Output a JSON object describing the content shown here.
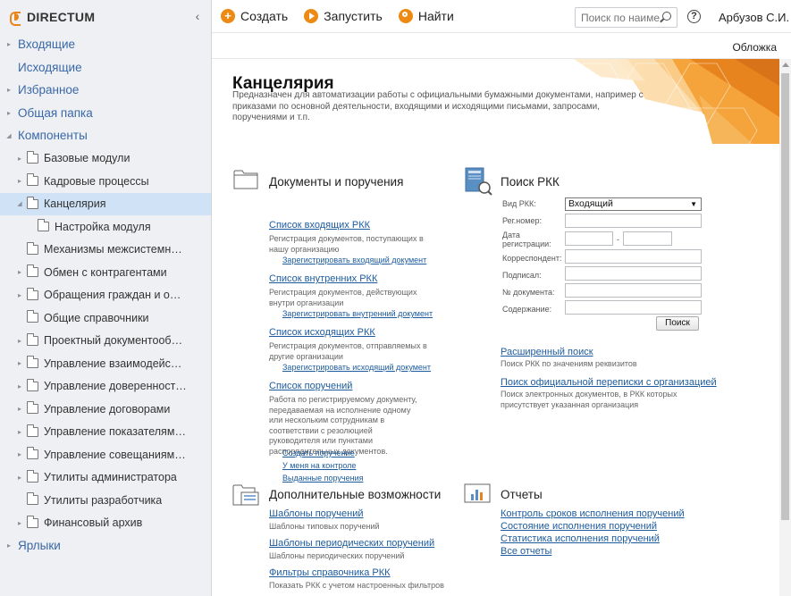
{
  "app": {
    "logo_text": "DIRECTUM",
    "collapse_icon": "chevron-left-icon"
  },
  "toolbar": {
    "create_label": "Создать",
    "run_label": "Запустить",
    "find_label": "Найти",
    "search_placeholder": "Поиск по наиме...",
    "user_name": "Арбузов С.И.",
    "accent_color": "#ec8a14"
  },
  "sidebar": {
    "items": [
      {
        "label": "Входящие",
        "level": 0,
        "expanded": false,
        "has_toggle": true
      },
      {
        "label": "Исходящие",
        "level": 0,
        "has_toggle": false
      },
      {
        "label": "Избранное",
        "level": 0,
        "expanded": false,
        "has_toggle": true
      },
      {
        "label": "Общая папка",
        "level": 0,
        "expanded": false,
        "has_toggle": true
      },
      {
        "label": "Компоненты",
        "level": 0,
        "expanded": true,
        "has_toggle": true
      },
      {
        "label": "Базовые модули",
        "level": 1,
        "has_toggle": true
      },
      {
        "label": "Кадровые процессы",
        "level": 1,
        "has_toggle": true
      },
      {
        "label": "Канцелярия",
        "level": 1,
        "has_toggle": true,
        "expanded": true,
        "selected": true
      },
      {
        "label": "Настройка модуля",
        "level": 2,
        "has_toggle": false
      },
      {
        "label": "Механизмы межсистемного обмена",
        "level": 1,
        "has_toggle": false
      },
      {
        "label": "Обмен с контрагентами",
        "level": 1,
        "has_toggle": true
      },
      {
        "label": "Обращения граждан и организаций",
        "level": 1,
        "has_toggle": true
      },
      {
        "label": "Общие справочники",
        "level": 1,
        "has_toggle": false
      },
      {
        "label": "Проектный документооборот",
        "level": 1,
        "has_toggle": true
      },
      {
        "label": "Управление взаимодействием",
        "level": 1,
        "has_toggle": true
      },
      {
        "label": "Управление доверенностями",
        "level": 1,
        "has_toggle": true
      },
      {
        "label": "Управление договорами",
        "level": 1,
        "has_toggle": true
      },
      {
        "label": "Управление показателями эффективности",
        "level": 1,
        "has_toggle": true
      },
      {
        "label": "Управление совещаниями и ВКС",
        "level": 1,
        "has_toggle": true
      },
      {
        "label": "Утилиты администратора",
        "level": 1,
        "has_toggle": true
      },
      {
        "label": "Утилиты разработчика",
        "level": 1,
        "has_toggle": false
      },
      {
        "label": "Финансовый архив",
        "level": 1,
        "has_toggle": true
      },
      {
        "label": "Ярлыки",
        "level": 0,
        "expanded": false,
        "has_toggle": true
      }
    ]
  },
  "content": {
    "cover_link": "Обложка",
    "title": "Канцелярия",
    "description": "Предназначен для автоматизации работы с официальными бумажными документами, например с приказами по основной деятельности, входящими и исходящими письмами, запросами, поручениями и т.п.",
    "documents": {
      "title": "Документы и поручения",
      "items": [
        {
          "link": "Список входящих РКК",
          "desc": "Регистрация документов, поступающих в нашу организацию",
          "subs": [
            "Зарегистрировать входящий документ"
          ]
        },
        {
          "link": "Список внутренних РКК",
          "desc": "Регистрация документов, действующих внутри организации",
          "subs": [
            "Зарегистрировать внутренний документ"
          ]
        },
        {
          "link": "Список исходящих РКК",
          "desc": "Регистрация документов, отправляемых в другие организации",
          "subs": [
            "Зарегистрировать исходящий документ"
          ]
        },
        {
          "link": "Список поручений",
          "desc": "Работа по регистрируемому документу, передаваемая на исполнение одному или нескольким сотрудникам в соответствии с резолюцией руководителя или пунктами распорядительных документов.",
          "subs": [
            "Создать поручение",
            "У меня на контроле",
            "Выданные поручения"
          ]
        }
      ]
    },
    "rkk_search": {
      "title": "Поиск РКК",
      "type_label": "Вид РКК:",
      "type_value": "Входящий",
      "reg_number_label": "Рег.номер:",
      "reg_date_label": "Дата регистрации:",
      "date_separator": "-",
      "correspondent_label": "Корреспондент:",
      "signed_label": "Подписал:",
      "doc_number_label": "№ документа:",
      "content_label": "Содержание:",
      "search_button": "Поиск",
      "extended_link": "Расширенный поиск",
      "extended_desc": "Поиск РКК по значениям реквизитов",
      "org_link": "Поиск официальной переписки с организацией",
      "org_desc": "Поиск электронных документов, в РКК которых присутствует указанная организация"
    },
    "extra": {
      "title": "Дополнительные возможности",
      "items": [
        {
          "link": "Шаблоны поручений",
          "desc": "Шаблоны типовых поручений"
        },
        {
          "link": "Шаблоны периодических поручений",
          "desc": "Шаблоны периодических поручений"
        },
        {
          "link": "Фильтры справочника РКК",
          "desc": "Показать РКК с учетом настроенных фильтров"
        }
      ]
    },
    "reports": {
      "title": "Отчеты",
      "items": [
        "Контроль сроков исполнения поручений",
        "Состояние исполнения поручений",
        "Статистика исполнения поручений",
        "Все отчеты"
      ]
    }
  }
}
